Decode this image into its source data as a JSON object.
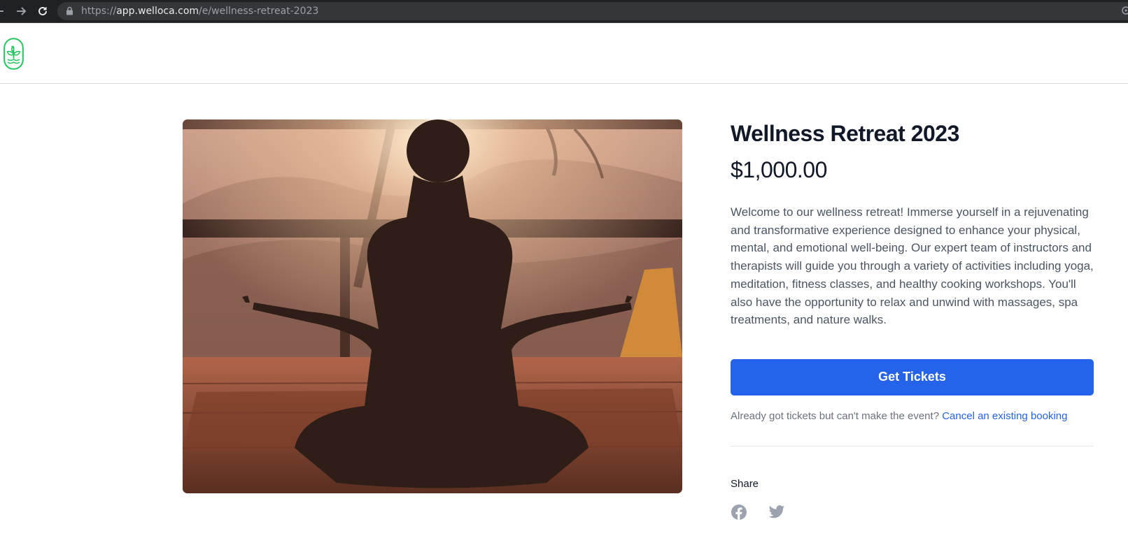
{
  "browser": {
    "url_scheme": "https://",
    "url_host": "app.welloca.com",
    "url_path": "/e/wellness-retreat-2023"
  },
  "event": {
    "title": "Wellness Retreat 2023",
    "price": "$1,000.00",
    "description": "Welcome to our wellness retreat! Immerse yourself in a rejuvenating and transformative experience designed to enhance your physical, mental, and emotional well-being. Our expert team of instructors and therapists will guide you through a variety of activities including yoga, meditation, fitness classes, and healthy cooking workshops. You'll also have the opportunity to relax and unwind with massages, spa treatments, and nature walks.",
    "cta_label": "Get Tickets",
    "cancel_prompt": "Already got tickets but can't make the event?",
    "cancel_link": "Cancel an existing booking",
    "share_label": "Share"
  },
  "icons": {
    "logo": "leaf-logo-icon",
    "share": [
      "facebook-icon",
      "twitter-icon"
    ]
  },
  "colors": {
    "accent": "#2563eb",
    "logo_green": "#22c55e",
    "heading": "#111827",
    "body_text": "#4b5563",
    "muted": "#9ca3af"
  }
}
